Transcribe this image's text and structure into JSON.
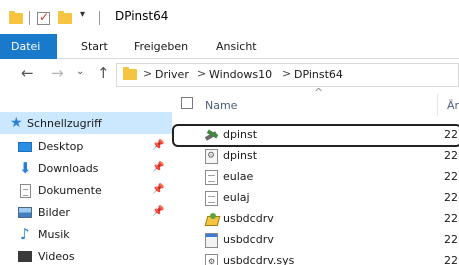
{
  "window": {
    "title": "DPinst64"
  },
  "ribbon": {
    "tabs": [
      "Datei",
      "Start",
      "Freigeben",
      "Ansicht"
    ]
  },
  "address": {
    "crumbs": [
      "Driver",
      "Windows10",
      "DPinst64"
    ],
    "separator": ">"
  },
  "navpane": {
    "group_label": "Schnellzugriff",
    "items": [
      {
        "label": "Desktop",
        "icon": "desktop-icon"
      },
      {
        "label": "Downloads",
        "icon": "download-arrow-icon"
      },
      {
        "label": "Dokumente",
        "icon": "document-icon"
      },
      {
        "label": "Bilder",
        "icon": "pictures-icon"
      },
      {
        "label": "Musik",
        "icon": "music-note-icon"
      },
      {
        "label": "Videos",
        "icon": "video-icon"
      }
    ]
  },
  "filepane": {
    "columns": {
      "name": "Name",
      "date": "Är"
    },
    "files": [
      {
        "name": "dpinst",
        "icon": "tools-exe-icon",
        "date": "22"
      },
      {
        "name": "dpinst",
        "icon": "config-file-icon",
        "date": "22"
      },
      {
        "name": "eulae",
        "icon": "text-file-icon",
        "date": "22"
      },
      {
        "name": "eulaj",
        "icon": "text-file-icon",
        "date": "22"
      },
      {
        "name": "usbdcdrv",
        "icon": "setup-info-icon",
        "date": "22"
      },
      {
        "name": "usbdcdrv",
        "icon": "catalog-file-icon",
        "date": "22"
      },
      {
        "name": "usbdcdrv.sys",
        "icon": "system-file-icon",
        "date": "22"
      }
    ]
  },
  "colors": {
    "accent": "#1979ca",
    "selection": "#cce8ff",
    "folder": "#f5c542"
  }
}
